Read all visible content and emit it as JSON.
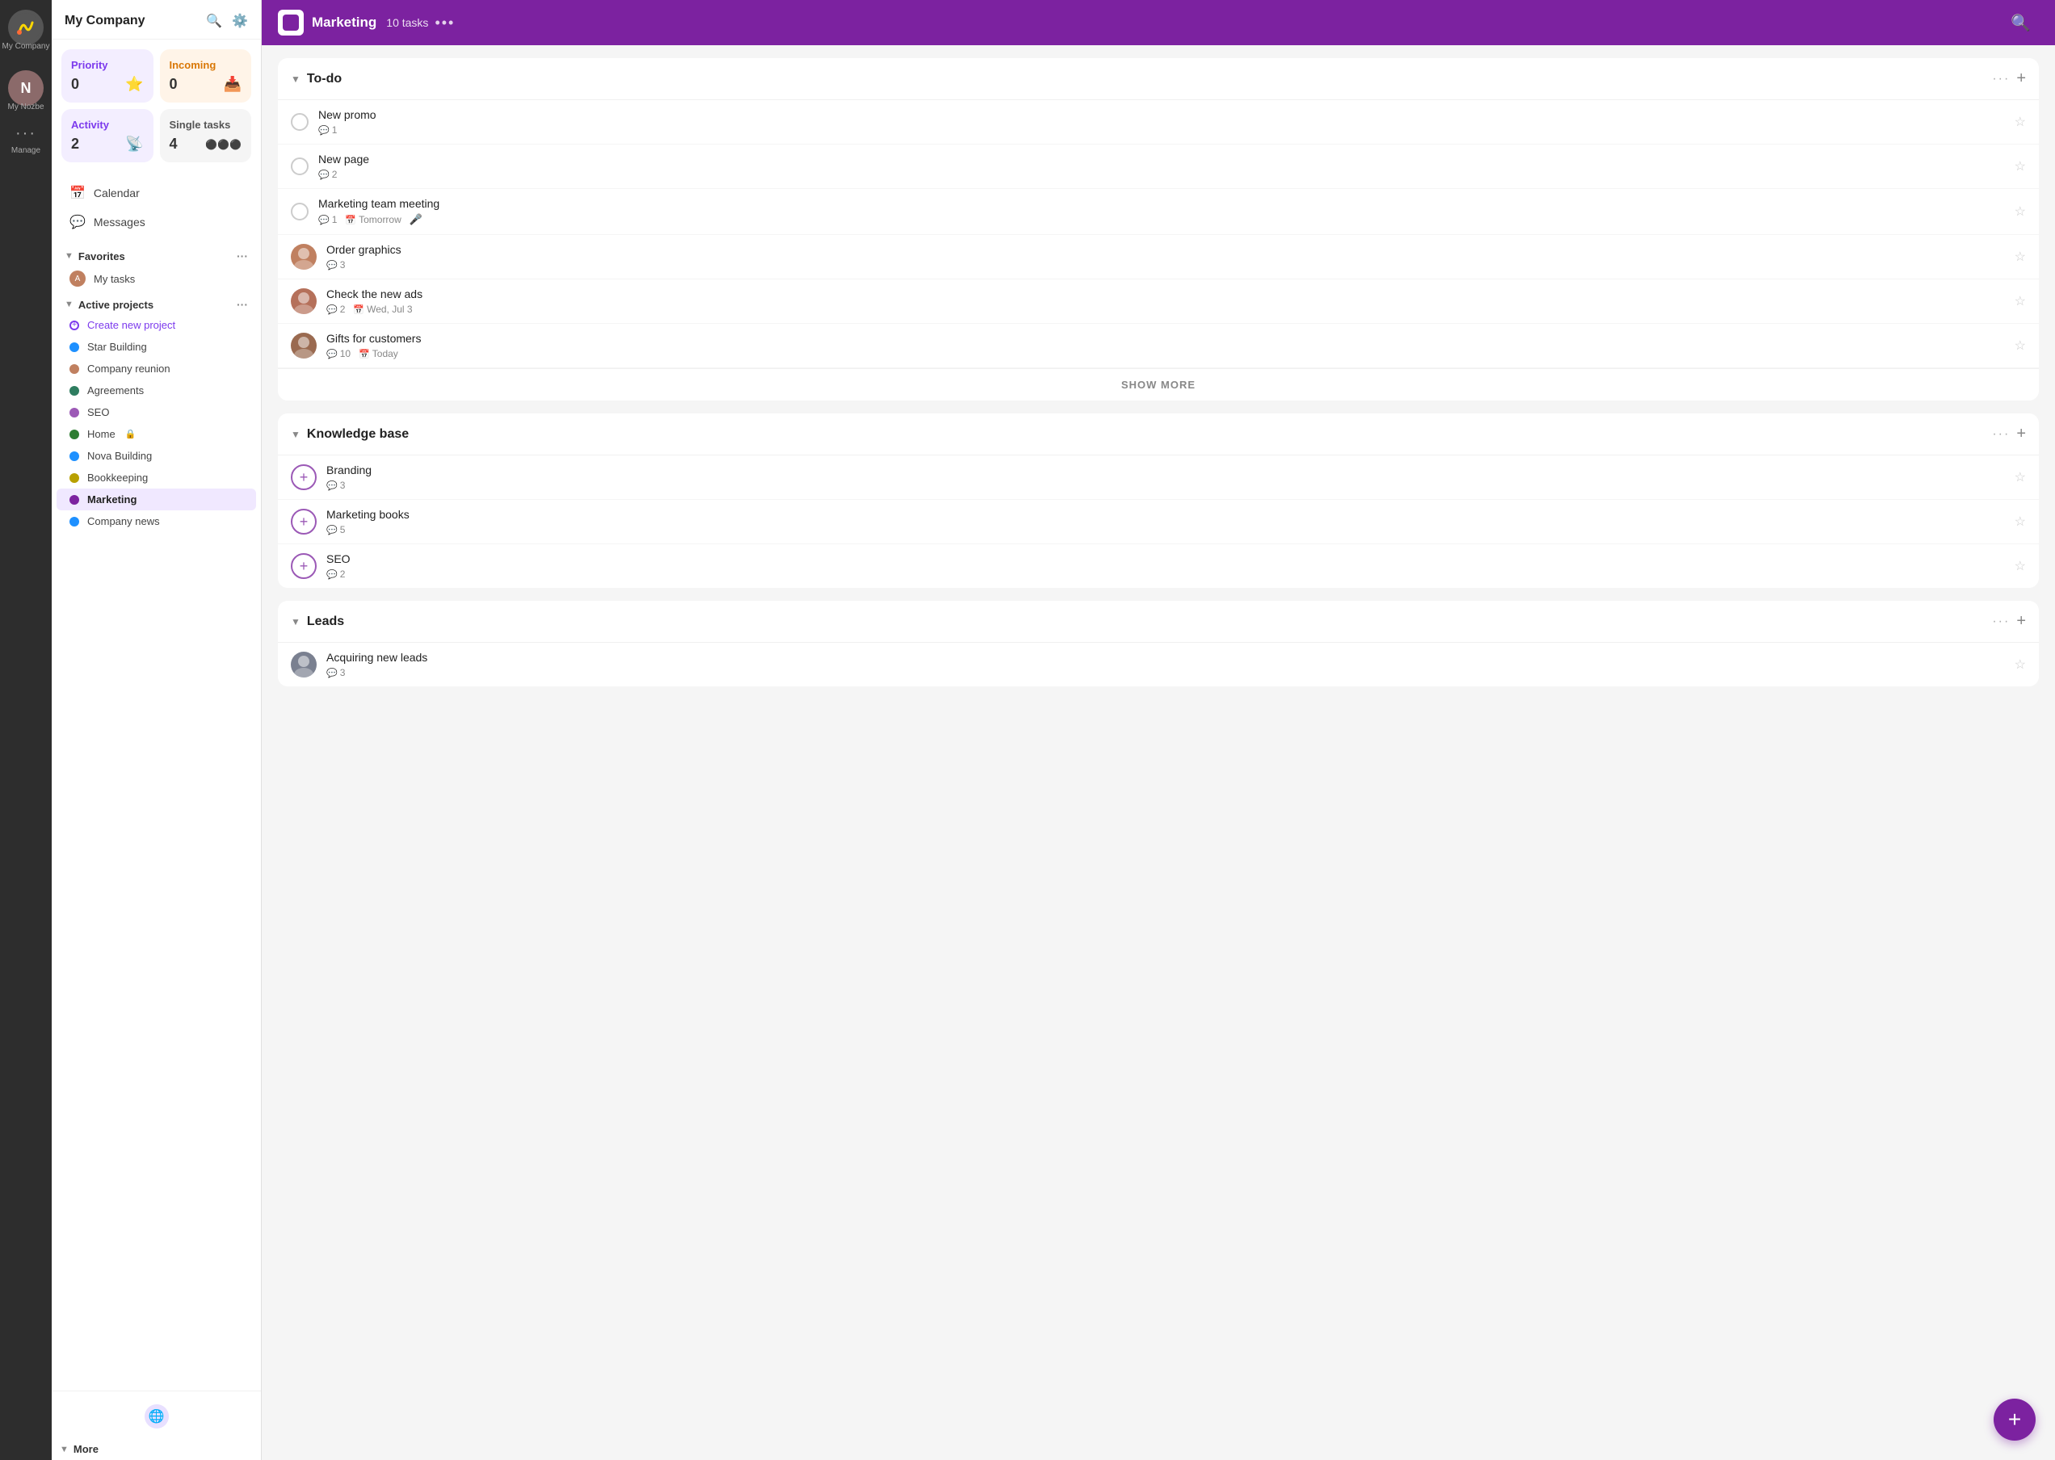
{
  "app": {
    "company": "My Company",
    "user_label": "My Nozbe",
    "manage_label": "Manage"
  },
  "sidebar": {
    "title": "My Company",
    "nav_items": [
      {
        "id": "calendar",
        "label": "Calendar",
        "icon": "📅"
      },
      {
        "id": "messages",
        "label": "Messages",
        "icon": "💬"
      }
    ],
    "favorites_label": "Favorites",
    "my_tasks_label": "My tasks",
    "active_projects_label": "Active projects",
    "create_project_label": "Create new project",
    "more_label": "More",
    "projects": [
      {
        "id": "star-building",
        "label": "Star Building",
        "color": "#1e90ff"
      },
      {
        "id": "company-reunion",
        "label": "Company reunion",
        "color": "#c08060"
      },
      {
        "id": "agreements",
        "label": "Agreements",
        "color": "#2e7d60"
      },
      {
        "id": "seo",
        "label": "SEO",
        "color": "#9c59b6"
      },
      {
        "id": "home",
        "label": "Home",
        "color": "#2e7d32",
        "locked": true
      },
      {
        "id": "nova-building",
        "label": "Nova Building",
        "color": "#1e90ff"
      },
      {
        "id": "bookkeeping",
        "label": "Bookkeeping",
        "color": "#b8a000"
      },
      {
        "id": "marketing",
        "label": "Marketing",
        "color": "#7c22a0",
        "active": true
      },
      {
        "id": "company-news",
        "label": "Company news",
        "color": "#1e90ff"
      }
    ]
  },
  "dashboard_cards": {
    "priority": {
      "title": "Priority",
      "count": "0",
      "icon": "⭐"
    },
    "incoming": {
      "title": "Incoming",
      "count": "0",
      "icon": "📥"
    },
    "activity": {
      "title": "Activity",
      "count": "2",
      "icon": "📡"
    },
    "single": {
      "title": "Single tasks",
      "count": "4",
      "icon": "⚫⚫⚫"
    }
  },
  "topbar": {
    "project_name": "Marketing",
    "tasks_count": "10 tasks",
    "more_icon": "•••"
  },
  "sections": [
    {
      "id": "todo",
      "title": "To-do",
      "tasks": [
        {
          "id": "new-promo",
          "name": "New promo",
          "comments": "1",
          "avatar": null,
          "date": null,
          "has_mic": false
        },
        {
          "id": "new-page",
          "name": "New page",
          "comments": "2",
          "avatar": null,
          "date": null,
          "has_mic": false
        },
        {
          "id": "marketing-team-meeting",
          "name": "Marketing team meeting",
          "comments": "1",
          "avatar": null,
          "date": "Tomorrow",
          "has_mic": true
        },
        {
          "id": "order-graphics",
          "name": "Order graphics",
          "comments": "3",
          "avatar": "person1",
          "date": null,
          "has_mic": false
        },
        {
          "id": "check-new-ads",
          "name": "Check the new ads",
          "comments": "2",
          "avatar": "person2",
          "date": "Wed, Jul 3",
          "has_mic": false
        },
        {
          "id": "gifts-customers",
          "name": "Gifts for customers",
          "comments": "10",
          "avatar": "person3",
          "date": "Today",
          "has_mic": false
        }
      ],
      "show_more": true
    },
    {
      "id": "knowledge-base",
      "title": "Knowledge base",
      "tasks": [
        {
          "id": "branding",
          "name": "Branding",
          "comments": "3",
          "avatar": "plus",
          "date": null,
          "has_mic": false
        },
        {
          "id": "marketing-books",
          "name": "Marketing books",
          "comments": "5",
          "avatar": "plus",
          "date": null,
          "has_mic": false
        },
        {
          "id": "seo",
          "name": "SEO",
          "comments": "2",
          "avatar": "plus",
          "date": null,
          "has_mic": false
        }
      ],
      "show_more": false
    },
    {
      "id": "leads",
      "title": "Leads",
      "tasks": [
        {
          "id": "acquiring-new-leads",
          "name": "Acquiring new leads",
          "comments": "3",
          "avatar": "person4",
          "date": null,
          "has_mic": false
        }
      ],
      "show_more": false
    }
  ],
  "fab": {
    "label": "+"
  }
}
